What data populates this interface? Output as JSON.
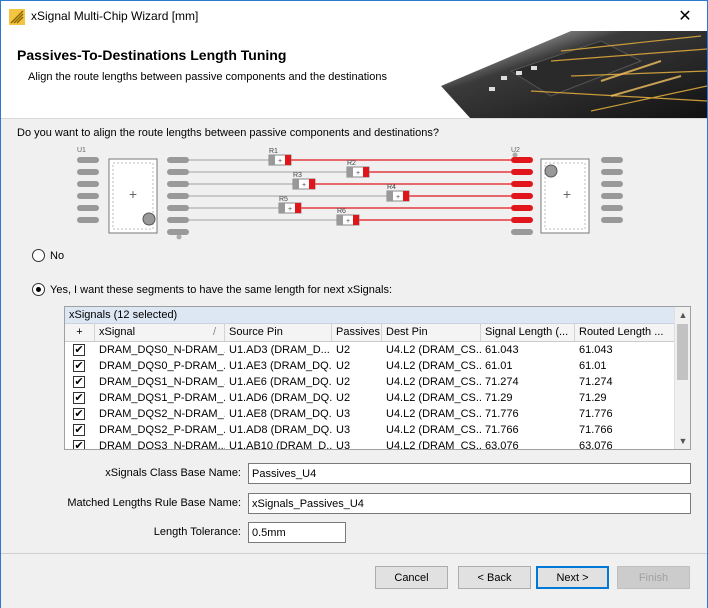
{
  "window": {
    "title": "xSignal Multi-Chip Wizard [mm]",
    "close_glyph": "✕"
  },
  "header": {
    "title": "Passives-To-Destinations Length Tuning",
    "subtitle": "Align the route lengths between passive components and the destinations"
  },
  "question": "Do you want to align the route lengths between passive components and destinations?",
  "diagram": {
    "left_ref": "U1",
    "right_ref": "U2",
    "resistors": [
      "R1",
      "R2",
      "R3",
      "R4",
      "R5",
      "R6"
    ]
  },
  "options": {
    "no_label": "No",
    "yes_label": "Yes, I want these segments to have the same length for next xSignals:",
    "selected": "yes"
  },
  "grid": {
    "caption": "xSignals (12 selected)",
    "columns": [
      "+",
      "xSignal",
      "Source Pin",
      "Passives",
      "Dest Pin",
      "Signal Length (...",
      "Routed Length ..."
    ],
    "sort_glyph": "/",
    "rows": [
      {
        "checked": true,
        "xsignal": "DRAM_DQS0_N-DRAM_...",
        "source": "U1.AD3 (DRAM_D...",
        "passive": "U2",
        "dest": "U4.L2 (DRAM_CS...",
        "signal_len": "61.043",
        "routed_len": "61.043"
      },
      {
        "checked": true,
        "xsignal": "DRAM_DQS0_P-DRAM_...",
        "source": "U1.AE3 (DRAM_DQ...",
        "passive": "U2",
        "dest": "U4.L2 (DRAM_CS...",
        "signal_len": "61.01",
        "routed_len": "61.01"
      },
      {
        "checked": true,
        "xsignal": "DRAM_DQS1_N-DRAM_...",
        "source": "U1.AE6 (DRAM_DQ...",
        "passive": "U2",
        "dest": "U4.L2 (DRAM_CS...",
        "signal_len": "71.274",
        "routed_len": "71.274"
      },
      {
        "checked": true,
        "xsignal": "DRAM_DQS1_P-DRAM_...",
        "source": "U1.AD6 (DRAM_DQ...",
        "passive": "U2",
        "dest": "U4.L2 (DRAM_CS...",
        "signal_len": "71.29",
        "routed_len": "71.29"
      },
      {
        "checked": true,
        "xsignal": "DRAM_DQS2_N-DRAM_...",
        "source": "U1.AE8 (DRAM_DQ...",
        "passive": "U3",
        "dest": "U4.L2 (DRAM_CS...",
        "signal_len": "71.776",
        "routed_len": "71.776"
      },
      {
        "checked": true,
        "xsignal": "DRAM_DQS2_P-DRAM_...",
        "source": "U1.AD8 (DRAM_DQ...",
        "passive": "U3",
        "dest": "U4.L2 (DRAM_CS...",
        "signal_len": "71.766",
        "routed_len": "71.766"
      },
      {
        "checked": true,
        "xsignal": "DRAM_DQS3_N-DRAM...",
        "source": "U1.AB10 (DRAM_D...",
        "passive": "U3",
        "dest": "U4.L2 (DRAM_CS...",
        "signal_len": "63.076",
        "routed_len": "63.076"
      }
    ]
  },
  "form": {
    "class_label": "xSignals Class Base Name:",
    "class_value": "Passives_U4",
    "rule_label": "Matched Lengths Rule Base Name:",
    "rule_value": "xSignals_Passives_U4",
    "tolerance_label": "Length Tolerance:",
    "tolerance_value": "0.5mm"
  },
  "buttons": {
    "cancel": "Cancel",
    "back": "< Back",
    "next": "Next >",
    "finish": "Finish"
  },
  "colors": {
    "accent": "#0078d7",
    "trace_red": "#e0161b",
    "trace_grey": "#b0b0b0"
  }
}
